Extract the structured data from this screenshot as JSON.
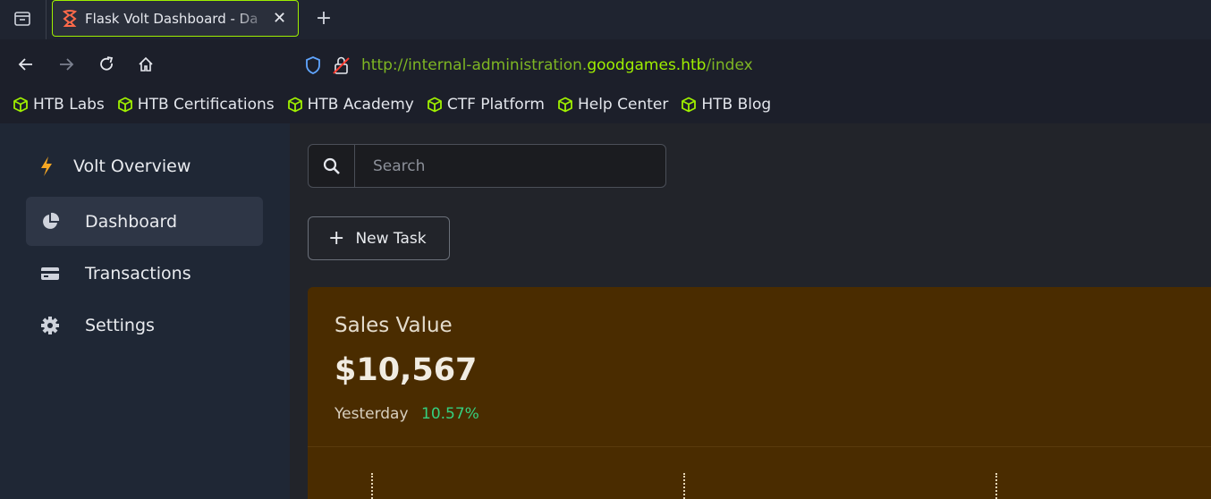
{
  "browser": {
    "tab_title": "Flask Volt Dashboard - Da",
    "url": {
      "prefix": "http://internal-administration.",
      "domain": "goodgames.htb",
      "path": "/index"
    },
    "bookmarks": [
      {
        "label": "HTB Labs",
        "icon": "box-icon"
      },
      {
        "label": "HTB Certifications",
        "icon": "box-icon"
      },
      {
        "label": "HTB Academy",
        "icon": "box-icon"
      },
      {
        "label": "CTF Platform",
        "icon": "box-icon"
      },
      {
        "label": "Help Center",
        "icon": "box-icon"
      },
      {
        "label": "HTB Blog",
        "icon": "box-icon"
      }
    ],
    "accent_color": "#9fef00"
  },
  "sidebar": {
    "brand": "Volt Overview",
    "items": [
      {
        "label": "Dashboard",
        "icon": "pie-chart-icon",
        "active": true
      },
      {
        "label": "Transactions",
        "icon": "credit-card-icon",
        "active": false
      },
      {
        "label": "Settings",
        "icon": "gear-icon",
        "active": false
      }
    ]
  },
  "main": {
    "search": {
      "placeholder": "Search",
      "value": ""
    },
    "new_task_label": "New Task",
    "sales": {
      "title": "Sales Value",
      "value": "$10,567",
      "period": "Yesterday",
      "change": "10.57%",
      "change_color": "#35d07f",
      "card_color": "#4a2c00"
    }
  }
}
